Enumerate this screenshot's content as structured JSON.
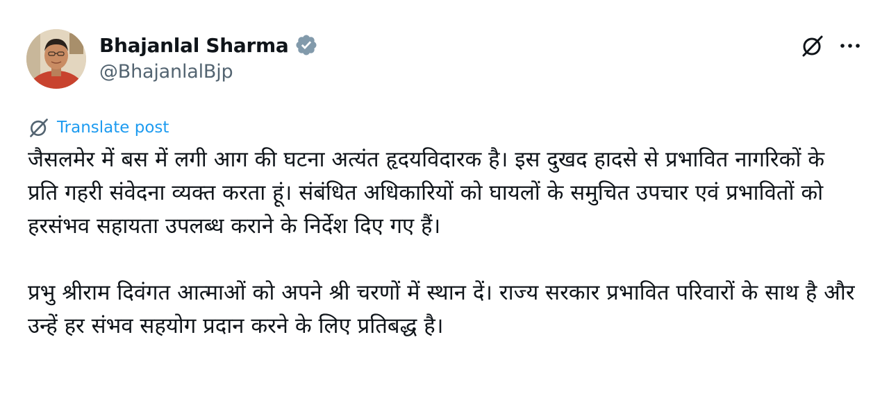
{
  "author": {
    "display_name": "Bhajanlal Sharma",
    "handle": "@BhajanlalBjp",
    "verified": true,
    "verified_color": "#829aab"
  },
  "actions": {
    "grok_icon": "grok-icon",
    "more_icon": "more-icon"
  },
  "translate": {
    "label": "Translate post",
    "color": "#1d9bf0"
  },
  "post": {
    "paragraphs": [
      "जैसलमेर में बस में लगी आग की घटना अत्यंत हृदयविदारक है। इस दुखद हादसे से प्रभावित नागरिकों के प्रति गहरी संवेदना व्यक्त करता हूं। संबंधित अधिकारियों को घायलों के समुचित उपचार एवं प्रभावितों को हरसंभव सहायता उपलब्ध कराने के निर्देश दिए गए हैं।",
      "प्रभु श्रीराम दिवंगत आत्माओं को अपने श्री चरणों में स्थान दें। राज्य सरकार प्रभावित परिवारों के साथ है और उन्हें हर संभव सहयोग प्रदान करने के लिए प्रतिबद्ध है।"
    ]
  }
}
